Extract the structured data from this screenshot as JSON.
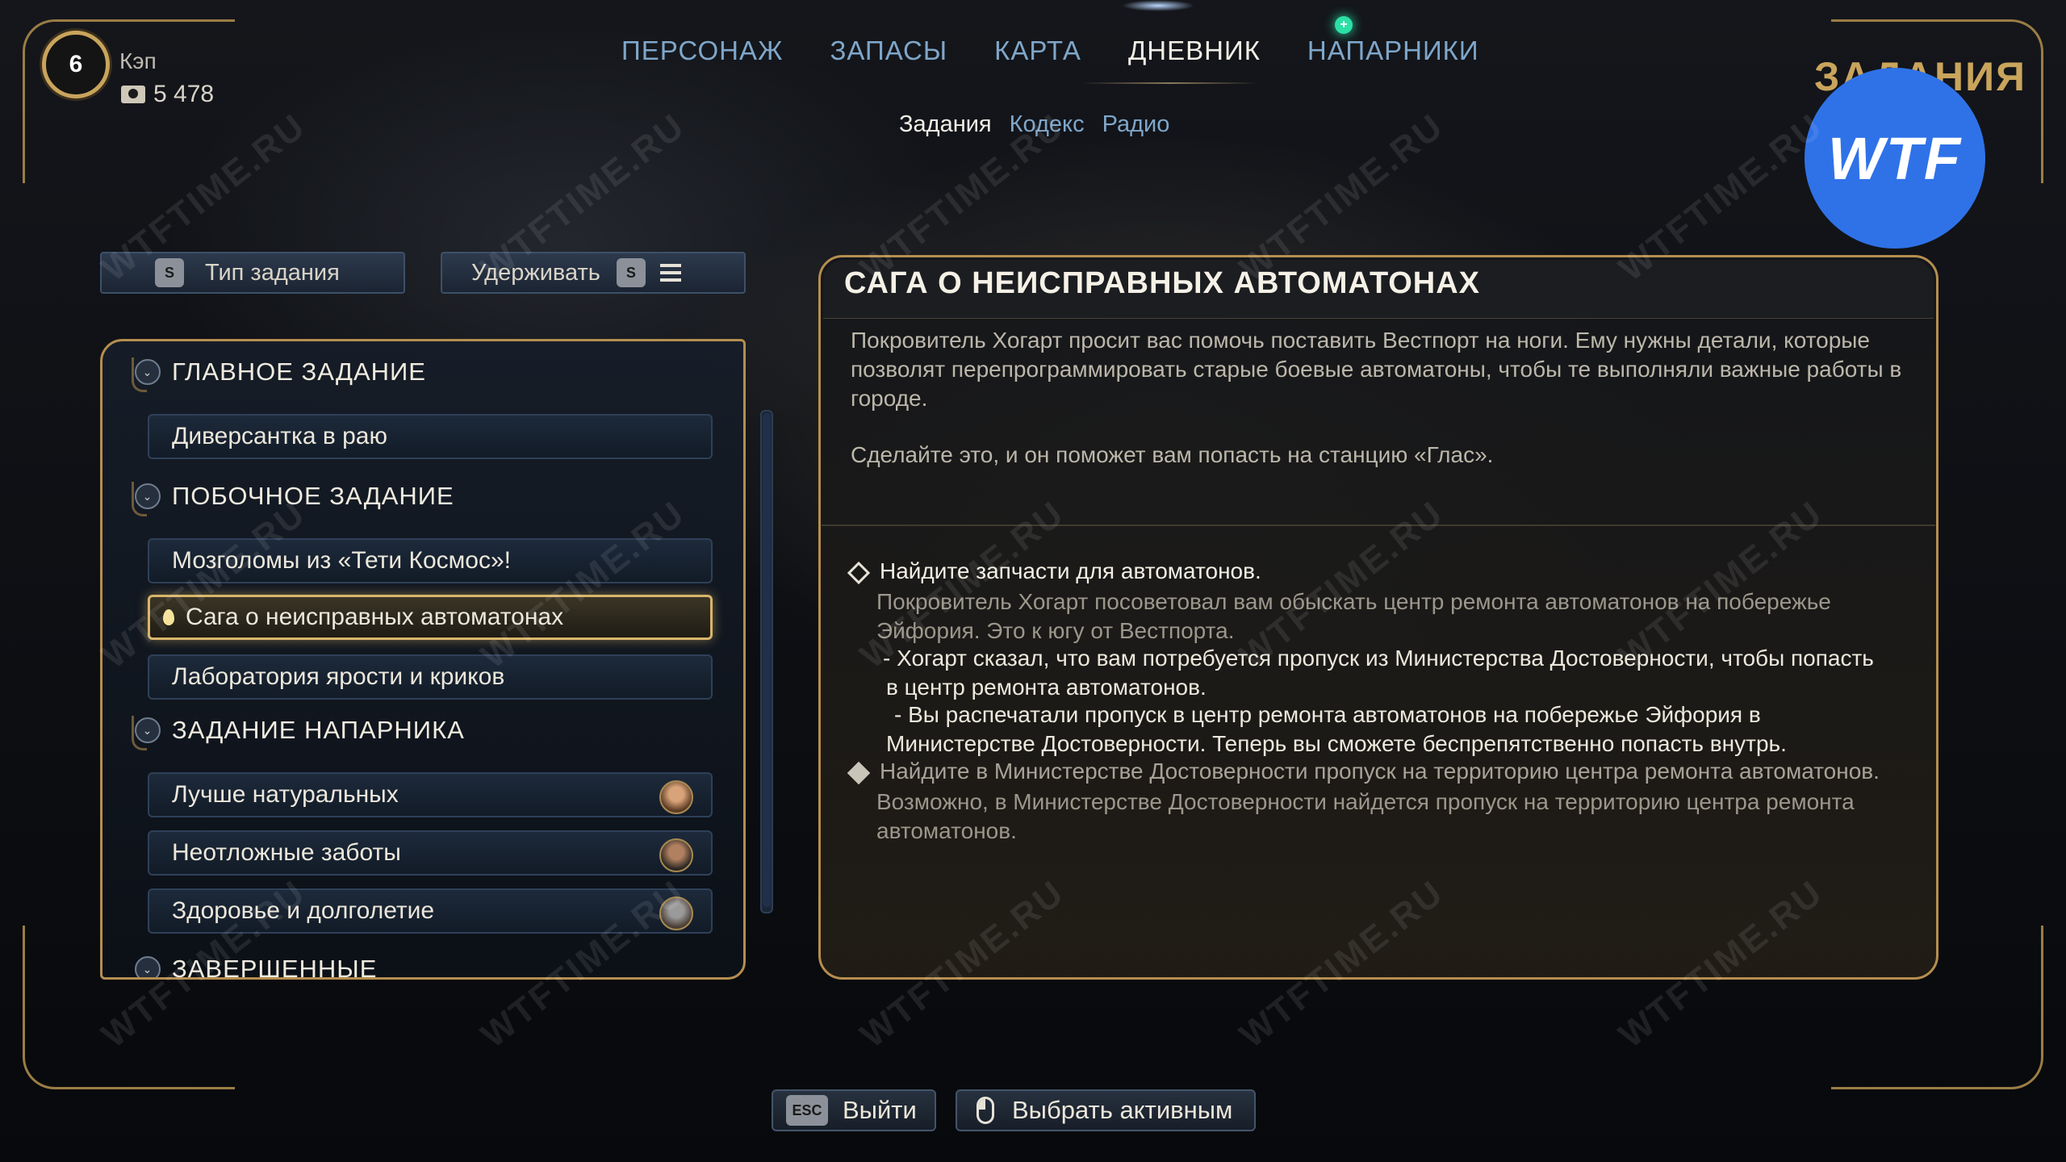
{
  "player": {
    "level": "6",
    "name": "Кэп",
    "money": "5 478"
  },
  "topnav": {
    "tabs": [
      "ПЕРСОНАЖ",
      "ЗАПАСЫ",
      "КАРТА",
      "ДНЕВНИК",
      "НАПАРНИКИ"
    ],
    "active": "ДНЕВНИК"
  },
  "subnav": {
    "tabs": [
      "Задания",
      "Кодекс",
      "Радио"
    ],
    "active": "Задания"
  },
  "section_label": "ЗАДАНИЯ",
  "watermark_badge": "WTF",
  "watermark_text": "WTFTIME.RU",
  "filters": {
    "type_key": "S",
    "type_label": "Тип задания",
    "hold_label": "Удерживать",
    "hold_key": "S"
  },
  "quest_list": {
    "categories": [
      {
        "title": "ГЛАВНОЕ ЗАДАНИЕ",
        "quests": [
          {
            "label": "Диверсантка в раю"
          }
        ]
      },
      {
        "title": "ПОБОЧНОЕ ЗАДАНИЕ",
        "quests": [
          {
            "label": "Мозголомы из «Тети Космос»!"
          },
          {
            "label": "Сага о неисправных автоматонах",
            "selected": true
          },
          {
            "label": "Лаборатория ярости и криков"
          }
        ]
      },
      {
        "title": "ЗАДАНИЕ НАПАРНИКА",
        "quests": [
          {
            "label": "Лучше натуральных"
          },
          {
            "label": "Неотложные заботы"
          },
          {
            "label": "Здоровье и долголетие"
          }
        ]
      },
      {
        "title": "ЗАВЕРШЕННЫЕ",
        "quests": []
      }
    ]
  },
  "detail": {
    "title": "САГА О НЕИСПРАВНЫХ АВТОМАТОНАХ",
    "description_1": "Покровитель Хогарт просит вас помочь поставить Вестпорт на ноги. Ему нужны детали, которые позволят перепрограммировать старые боевые автоматоны, чтобы те выполняли важные работы в городе.",
    "description_2": "Сделайте это, и он поможет вам попасть на станцию «Глас».",
    "objectives": [
      {
        "title": "Найдите запчасти для автоматонов.",
        "note": "Покровитель Хогарт посоветовал вам обыскать центр ремонта автоматонов на побережье Эйфория. Это к югу от Вестпорта.",
        "sub_1": "- Хогарт сказал, что вам потребуется пропуск из Министерства Достоверности, чтобы попасть в центр ремонта автоматонов.",
        "sub_2": "- Вы распечатали пропуск в центр ремонта автоматонов на побережье Эйфория в Министерстве Достоверности. Теперь вы сможете беспрепятственно попасть внутрь."
      },
      {
        "title": "Найдите в Министерстве Достоверности пропуск на территорию центра ремонта автоматонов.",
        "note": "Возможно, в Министерстве Достоверности найдется пропуск на территорию центра ремонта автоматонов."
      }
    ]
  },
  "bottom": {
    "esc_key": "ESC",
    "exit_label": "Выйти",
    "select_label": "Выбрать активным"
  },
  "colors": {
    "gold": "#c9a45c",
    "nav_inactive": "#7fa6c9",
    "badge_blue": "#2f72e8"
  }
}
